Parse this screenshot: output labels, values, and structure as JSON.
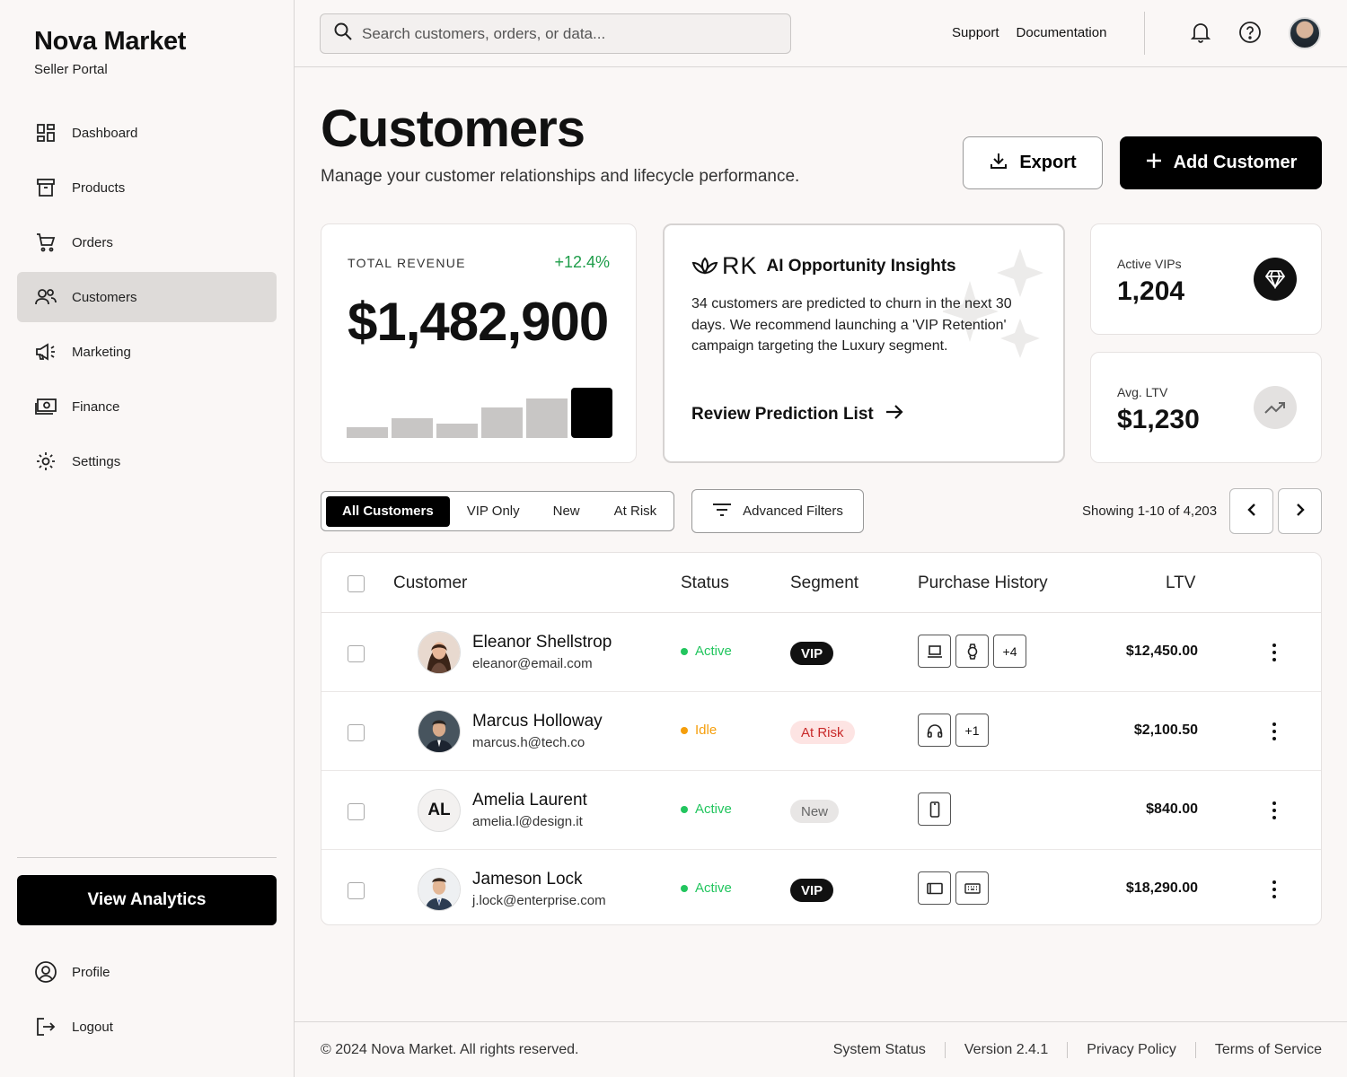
{
  "brand": {
    "name": "Nova Market",
    "subtitle": "Seller Portal"
  },
  "sidebar": {
    "items": [
      {
        "label": "Dashboard",
        "icon": "dashboard-icon"
      },
      {
        "label": "Products",
        "icon": "archive-box-icon"
      },
      {
        "label": "Orders",
        "icon": "cart-icon"
      },
      {
        "label": "Customers",
        "icon": "users-icon",
        "active": true
      },
      {
        "label": "Marketing",
        "icon": "megaphone-icon"
      },
      {
        "label": "Finance",
        "icon": "money-icon"
      },
      {
        "label": "Settings",
        "icon": "gear-icon"
      }
    ],
    "cta_label": "View Analytics",
    "bottom_items": [
      {
        "label": "Profile",
        "icon": "user-circle-icon"
      },
      {
        "label": "Logout",
        "icon": "logout-icon"
      }
    ]
  },
  "topbar": {
    "search_placeholder": "Search customers, orders, or data...",
    "links": [
      "Support",
      "Documentation"
    ]
  },
  "header": {
    "title": "Customers",
    "subtitle": "Manage your customer relationships and lifecycle performance.",
    "export_label": "Export",
    "add_label": "Add Customer"
  },
  "revenue": {
    "label": "TOTAL REVENUE",
    "change": "+12.4%",
    "value": "$1,482,900",
    "bars": [
      0.17,
      0.33,
      0.23,
      0.5,
      0.65,
      0.82
    ],
    "highlight_color": "#000000",
    "bar_color": "#c8c6c5"
  },
  "ai": {
    "logo_text": "RK",
    "title": "AI Opportunity Insights",
    "body": "34 customers are predicted to churn in the next 30 days. We recommend launching a 'VIP Retention' campaign targeting the Luxury segment.",
    "link": "Review Prediction List"
  },
  "stats": {
    "vips": {
      "label": "Active VIPs",
      "value": "1,204",
      "icon": "diamond-icon"
    },
    "ltv": {
      "label": "Avg. LTV",
      "value": "$1,230",
      "icon": "trending-up-icon"
    }
  },
  "filters": {
    "tabs": [
      "All Customers",
      "VIP Only",
      "New",
      "At Risk"
    ],
    "advanced_label": "Advanced Filters",
    "showing": "Showing 1-10 of 4,203"
  },
  "table": {
    "headers": {
      "customer": "Customer",
      "status": "Status",
      "segment": "Segment",
      "purchase": "Purchase History",
      "ltv": "LTV"
    },
    "rows": [
      {
        "name": "Eleanor Shellstrop",
        "email": "eleanor@email.com",
        "status": "Active",
        "status_color": "#22c55e",
        "segment": "VIP",
        "segment_type": "vip",
        "items": [
          "laptop-icon",
          "watch-icon"
        ],
        "more": "+4",
        "ltv": "$12,450.00",
        "avatar": "photo-woman"
      },
      {
        "name": "Marcus Holloway",
        "email": "marcus.h@tech.co",
        "status": "Idle",
        "status_color": "#f59e0b",
        "segment": "At Risk",
        "segment_type": "risk",
        "items": [
          "headphones-icon"
        ],
        "more": "+1",
        "ltv": "$2,100.50",
        "avatar": "photo-man"
      },
      {
        "name": "Amelia Laurent",
        "email": "amelia.l@design.it",
        "status": "Active",
        "status_color": "#22c55e",
        "segment": "New",
        "segment_type": "new",
        "items": [
          "phone-icon"
        ],
        "more": "",
        "ltv": "$840.00",
        "avatar": "AL"
      },
      {
        "name": "Jameson Lock",
        "email": "j.lock@enterprise.com",
        "status": "Active",
        "status_color": "#22c55e",
        "segment": "VIP",
        "segment_type": "vip",
        "items": [
          "tablet-icon",
          "keyboard-icon"
        ],
        "more": "",
        "ltv": "$18,290.00",
        "avatar": "photo-man2"
      }
    ]
  },
  "footer": {
    "copyright": "© 2024 Nova Market. All rights reserved.",
    "links": [
      "System Status",
      "Version 2.4.1",
      "Privacy Policy",
      "Terms of Service"
    ]
  }
}
